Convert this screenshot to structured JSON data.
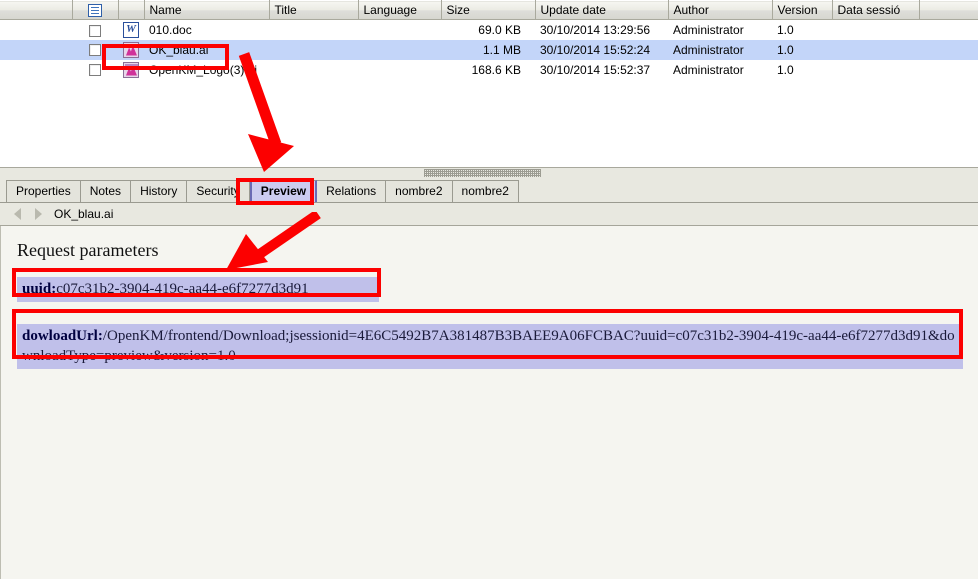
{
  "filelist": {
    "columns": [
      {
        "key": "pad",
        "label": "",
        "align": "left"
      },
      {
        "key": "select",
        "label": "",
        "align": "center",
        "icon": "list-icon"
      },
      {
        "key": "type",
        "label": "",
        "align": "center"
      },
      {
        "key": "name",
        "label": "Name",
        "align": "left"
      },
      {
        "key": "title",
        "label": "Title",
        "align": "left"
      },
      {
        "key": "language",
        "label": "Language",
        "align": "left"
      },
      {
        "key": "size",
        "label": "Size",
        "align": "left"
      },
      {
        "key": "updated",
        "label": "Update date",
        "align": "left"
      },
      {
        "key": "author",
        "label": "Author",
        "align": "left"
      },
      {
        "key": "version",
        "label": "Version",
        "align": "left"
      },
      {
        "key": "session",
        "label": "Data sessió",
        "align": "left"
      },
      {
        "key": "tail",
        "label": "",
        "align": "left"
      }
    ],
    "rows": [
      {
        "checked": false,
        "icon": "word-document-icon",
        "name": "010.doc",
        "title": "",
        "language": "",
        "size": "69.0 KB",
        "updated": "30/10/2014 13:29:56",
        "author": "Administrator",
        "version": "1.0",
        "session": "",
        "selected": false
      },
      {
        "checked": false,
        "icon": "illustrator-file-icon",
        "name": "OK_blau.ai",
        "title": "",
        "language": "",
        "size": "1.1 MB",
        "updated": "30/10/2014 15:52:24",
        "author": "Administrator",
        "version": "1.0",
        "session": "",
        "selected": true
      },
      {
        "checked": false,
        "icon": "illustrator-file-icon",
        "name": "OpenKM_Logo(3).ai",
        "title": "",
        "language": "",
        "size": "168.6 KB",
        "updated": "30/10/2014 15:52:37",
        "author": "Administrator",
        "version": "1.0",
        "session": "",
        "selected": false
      }
    ]
  },
  "tabs": [
    {
      "label": "Properties",
      "selected": false
    },
    {
      "label": "Notes",
      "selected": false
    },
    {
      "label": "History",
      "selected": false
    },
    {
      "label": "Security",
      "selected": false
    },
    {
      "label": "Preview",
      "selected": true
    },
    {
      "label": "Relations",
      "selected": false
    },
    {
      "label": "nombre2",
      "selected": false
    },
    {
      "label": "nombre2",
      "selected": false
    }
  ],
  "breadcrumb": {
    "label": "OK_blau.ai",
    "back_icon": "triangle-left-icon",
    "forward_icon": "triangle-right-icon"
  },
  "preview": {
    "heading": "Request parameters",
    "uuid_label": "uuid:",
    "uuid_value": "c07c31b2-3904-419c-aa44-e6f7277d3d91",
    "url_label": "dowloadUrl:",
    "url_value": "/OpenKM/frontend/Download;jsessionid=4E6C5492B7A381487B3BAEE9A06FCBAC?uuid=c07c31b2-3904-419c-aa44-e6f7277d3d91&downloadType=preview&version=1.0"
  },
  "annotations": {
    "highlight_color": "#fc0000",
    "boxes": [
      {
        "name": "name-cell-highlight"
      },
      {
        "name": "preview-tab-highlight"
      },
      {
        "name": "uuid-highlight"
      },
      {
        "name": "download-url-highlight"
      }
    ],
    "arrows": [
      {
        "name": "arrow-file-to-tab"
      },
      {
        "name": "arrow-tab-to-uuid"
      }
    ]
  },
  "colors": {
    "selection_row": "#c3d5f9",
    "text_highlight": "#c0c0ea",
    "selected_tab": "#ccccf0",
    "annotation_red": "#fc0000",
    "panel_bg": "#e8e8e0",
    "content_bg": "#f5f5f0"
  }
}
